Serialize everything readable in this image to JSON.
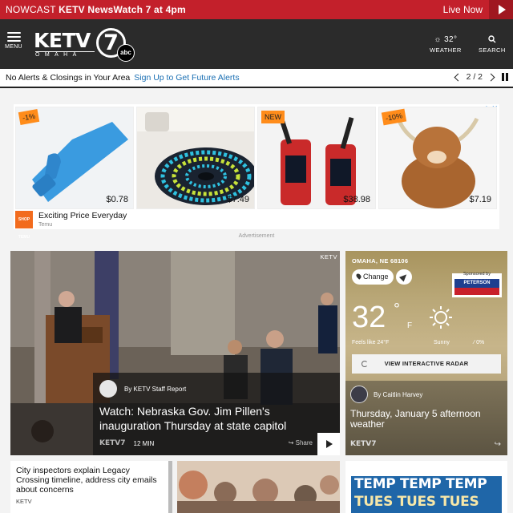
{
  "topbar": {
    "nowcast_prefix": "NOWCAST",
    "nowcast_title": "KETV NewsWatch 7 at 4pm",
    "live_label": "Live Now",
    "bg_color": "#c3202b"
  },
  "header": {
    "menu_label": "MENU",
    "logo_text": "KETV",
    "logo_city": "OMAHA",
    "logo_number": "7",
    "logo_network": "abc",
    "weather_temp": "32°",
    "weather_label": "WEATHER",
    "search_label": "SEARCH",
    "bg_color": "#2b2b2b"
  },
  "alerts": {
    "text": "No Alerts & Closings in Your Area",
    "signup": "Sign Up to Get Future Alerts",
    "pager": "2 / 2"
  },
  "ad": {
    "products": [
      {
        "price": "$0.78",
        "badge": "-1%"
      },
      {
        "price": "$7.49",
        "badge": ""
      },
      {
        "price": "$38.98",
        "badge": "NEW"
      },
      {
        "price": "$7.19",
        "badge": "-10%"
      }
    ],
    "slogan": "Exciting Price Everyday",
    "brand": "Temu",
    "icon_text": "SHOP TEMU",
    "label": "Advertisement"
  },
  "hero": {
    "source_tag": "KETV",
    "author": "By KETV Staff Report",
    "headline": "Watch: Nebraska Gov. Jim Pillen's inauguration Thursday at state capitol",
    "duration": "12 MIN",
    "logo": "KETV7",
    "share": "Share"
  },
  "weather": {
    "location": "OMAHA, NE 68106",
    "change_label": "Change",
    "sponsor_label": "Sponsored by",
    "sponsor_name": "PETERSON",
    "temp": "32",
    "deg": "°",
    "unit": "F",
    "feels_like": "Feels like 24°F",
    "condition": "Sunny",
    "precip": "0%",
    "radar_label": "VIEW INTERACTIVE RADAR",
    "author": "By Caitlin Harvey",
    "headline": "Thursday, January 5 afternoon weather",
    "logo": "KETV7"
  },
  "cards": [
    {
      "title": "City inspectors explain Legacy Crossing timeline, address city emails about concerns",
      "source": "KETV"
    },
    {
      "title": "",
      "source": ""
    },
    {
      "art_text": [
        "TEMP TEMP TEMP",
        "TUES TUES TUES"
      ]
    }
  ]
}
